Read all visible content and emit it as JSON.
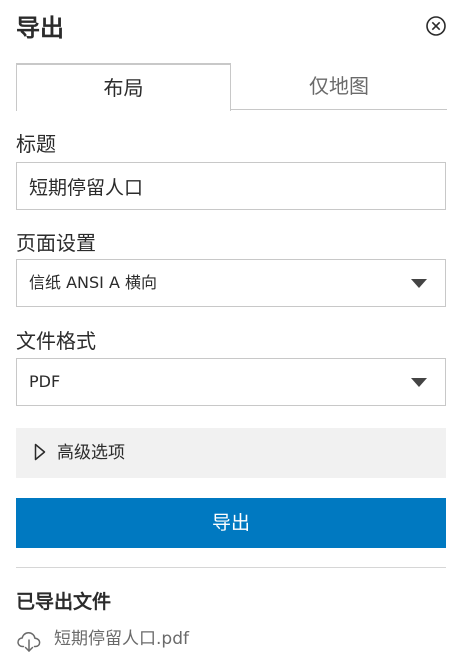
{
  "header": {
    "title": "导出",
    "close_icon": "close-circle-icon"
  },
  "tabs": [
    {
      "label": "布局",
      "active": true
    },
    {
      "label": "仅地图",
      "active": false
    }
  ],
  "form": {
    "title_label": "标题",
    "title_value": "短期停留人口",
    "page_setup_label": "页面设置",
    "page_setup_value": "信纸 ANSI A 横向",
    "file_format_label": "文件格式",
    "file_format_value": "PDF"
  },
  "advanced": {
    "label": "高级选项",
    "icon": "triangle-right-icon"
  },
  "export_button": {
    "label": "导出",
    "color": "#0079c1"
  },
  "exported": {
    "title": "已导出文件",
    "files": [
      {
        "name": "短期停留人口.pdf",
        "icon": "cloud-download-icon"
      }
    ]
  }
}
